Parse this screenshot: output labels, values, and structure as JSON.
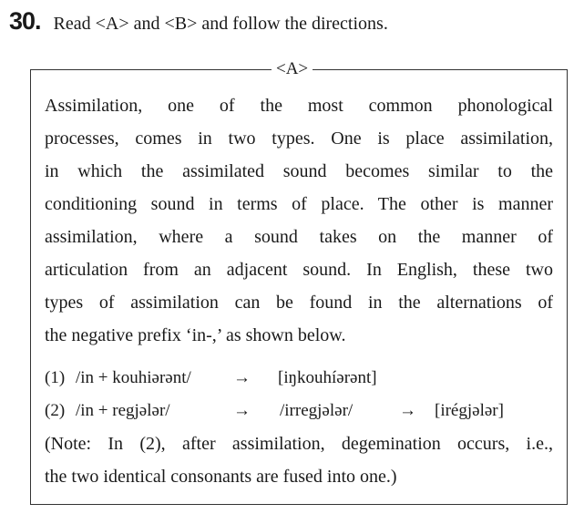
{
  "question": {
    "number": "30.",
    "instruction": "Read <A> and <B> and follow the directions."
  },
  "box": {
    "label": "<A>",
    "paragraph_lines": [
      "  Assimilation, one of the most common phonological",
      "processes, comes in two types. One is place assimilation,",
      "in which the assimilated sound becomes similar to the",
      "conditioning sound in terms of place. The other is manner",
      "assimilation, where a sound takes on the manner of",
      "articulation from an adjacent sound. In English, these two",
      "types of assimilation can be found in the alternations of",
      "the negative prefix ‘in-,’ as shown below."
    ],
    "examples": [
      {
        "num": "(1)",
        "underlying": "/in + kouhiərənt/",
        "arrow1": "→",
        "surface": "[iŋkouhíərənt]"
      },
      {
        "num": "(2)",
        "underlying": "/in + regjələr/",
        "arrow1": "→",
        "intermediate": "/irregjələr/",
        "arrow2": "→",
        "surface": "[irégjələr]"
      }
    ],
    "note_lines": [
      "(Note: In (2), after assimilation, degemination occurs, i.e.,",
      "the two identical consonants are fused into one.)"
    ]
  }
}
